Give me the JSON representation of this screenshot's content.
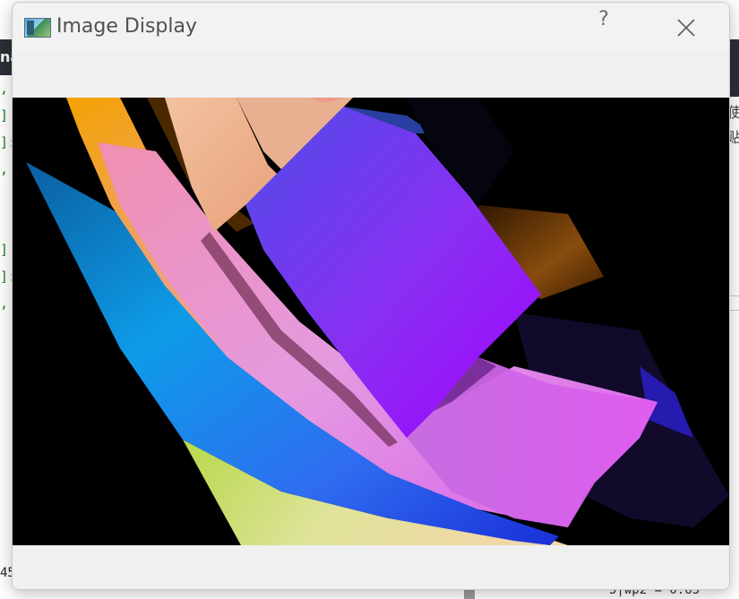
{
  "window": {
    "title": "Image Display",
    "help_label": "?"
  },
  "background": {
    "left_top_char": "na",
    "left_chars": [
      ",",
      "]",
      "]:",
      ",",
      "",
      "",
      "]",
      "]:",
      ","
    ],
    "left_bottom_char": "45",
    "right_chars": [
      "使",
      "贴"
    ],
    "bottom_code": "5|wp2 = 0.65"
  }
}
